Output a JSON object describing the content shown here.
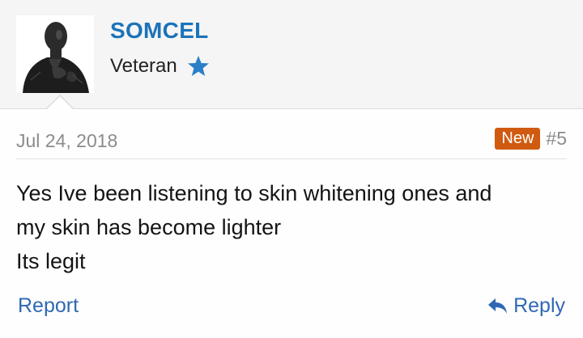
{
  "user": {
    "name": "SOMCEL",
    "title": "Veteran",
    "badge_icon": "star-icon",
    "name_color": "#1c73b8"
  },
  "post": {
    "date": "Jul 24, 2018",
    "new_label": "New",
    "number": "#5",
    "lines": [
      "Yes Ive been listening to skin whitening ones and",
      "my skin has become lighter",
      "Its legit"
    ]
  },
  "actions": {
    "report_label": "Report",
    "reply_label": "Reply",
    "reply_icon": "reply-icon",
    "link_color": "#2f68b4"
  }
}
